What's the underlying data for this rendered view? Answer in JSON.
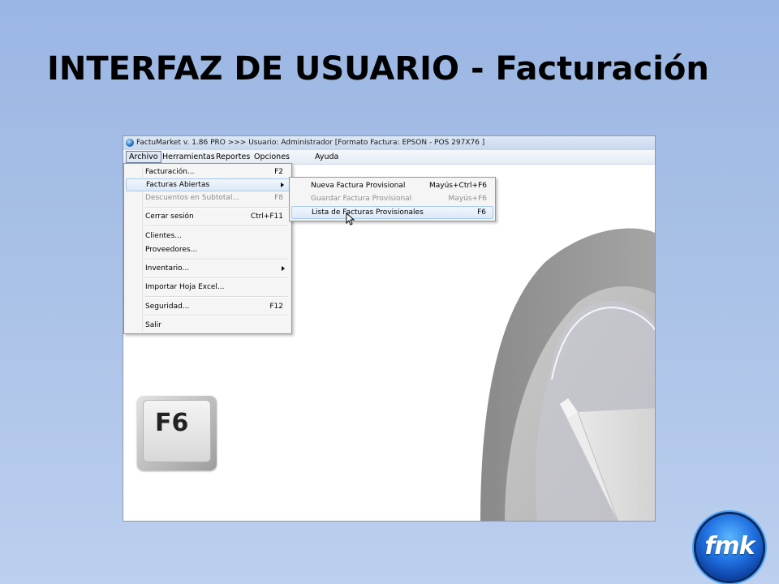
{
  "slide": {
    "title": "INTERFAZ DE USUARIO - Facturación"
  },
  "app": {
    "title": "FactuMarket v. 1.86 PRO >>>  Usuario: Administrador [Formato Factura: EPSON - POS 297X76 ]",
    "icon": "app-globe-icon"
  },
  "menubar": {
    "items": [
      "Archivo",
      "Herramientas",
      "Reportes",
      "Opciones",
      "Ayuda"
    ],
    "active": "Archivo"
  },
  "archivo_menu": {
    "items": [
      {
        "label": "Facturación...",
        "shortcut": "F2"
      },
      {
        "label": "Facturas Abiertas",
        "submenu": true,
        "highlighted": true
      },
      {
        "label": "Descuentos en Subtotal...",
        "shortcut": "F8",
        "disabled": true
      },
      {
        "label": "Cerrar sesión",
        "shortcut": "Ctrl+F11"
      },
      {
        "label": "Clientes..."
      },
      {
        "label": "Proveedores..."
      },
      {
        "label": "Inventario...",
        "submenu": true
      },
      {
        "label": "Importar Hoja Excel..."
      },
      {
        "label": "Seguridad...",
        "shortcut": "F12"
      },
      {
        "label": "Salir"
      }
    ]
  },
  "facturas_abiertas_submenu": {
    "items": [
      {
        "label": "Nueva Factura Provisional",
        "shortcut": "Mayús+Ctrl+F6"
      },
      {
        "label": "Guardar Factura Provisional",
        "shortcut": "Mayús+F6",
        "disabled": true
      },
      {
        "label": "Lista de Facturas Provisionales",
        "shortcut": "F6",
        "highlighted": true
      }
    ]
  },
  "key_hint": {
    "label": "F6"
  },
  "logo": {
    "text": "fmk",
    "color": "#1f6fe0"
  },
  "colors": {
    "background": "#a9c1e7",
    "menu_highlight": "#dce9f7"
  }
}
